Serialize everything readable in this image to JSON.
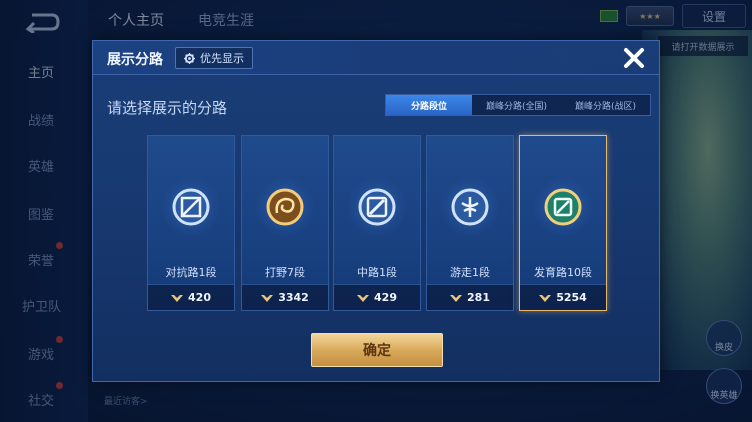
{
  "background": {
    "nav_items": [
      {
        "label": "主页",
        "active": true
      },
      {
        "label": "战绩",
        "active": false
      },
      {
        "label": "英雄",
        "active": false
      },
      {
        "label": "图鉴",
        "active": false
      },
      {
        "label": "荣誉",
        "active": false
      },
      {
        "label": "护卫队",
        "active": false
      },
      {
        "label": "游戏",
        "active": false
      },
      {
        "label": "社交",
        "active": false
      }
    ],
    "top_tabs": [
      "个人主页",
      "电竞生涯"
    ],
    "settings_label": "设置",
    "right_note": "请打开数据展示",
    "skin_label": "换皮",
    "hero_label": "换英雄",
    "visitor_text": "最近访客>"
  },
  "modal": {
    "title": "展示分路",
    "priority_label": "优先显示",
    "prompt": "请选择展示的分路",
    "tabs": [
      {
        "label": "分路段位",
        "active": true
      },
      {
        "label": "巅峰分路(全国)",
        "active": false
      },
      {
        "label": "巅峰分路(战区)",
        "active": false
      }
    ],
    "cards": [
      {
        "rank": "对抗路1段",
        "score": "420",
        "emblem": "shield-icon",
        "selected": false
      },
      {
        "rank": "打野7段",
        "score": "3342",
        "emblem": "dragon-icon",
        "selected": false
      },
      {
        "rank": "中路1段",
        "score": "429",
        "emblem": "mid-lane-icon",
        "selected": false
      },
      {
        "rank": "游走1段",
        "score": "281",
        "emblem": "support-icon",
        "selected": false
      },
      {
        "rank": "发育路10段",
        "score": "5254",
        "emblem": "adc-icon",
        "selected": true
      }
    ],
    "confirm_label": "确定"
  },
  "colors": {
    "accent_blue": "#2f74dc",
    "gold": "#e9b96a",
    "card_bg": "#1a4282"
  }
}
